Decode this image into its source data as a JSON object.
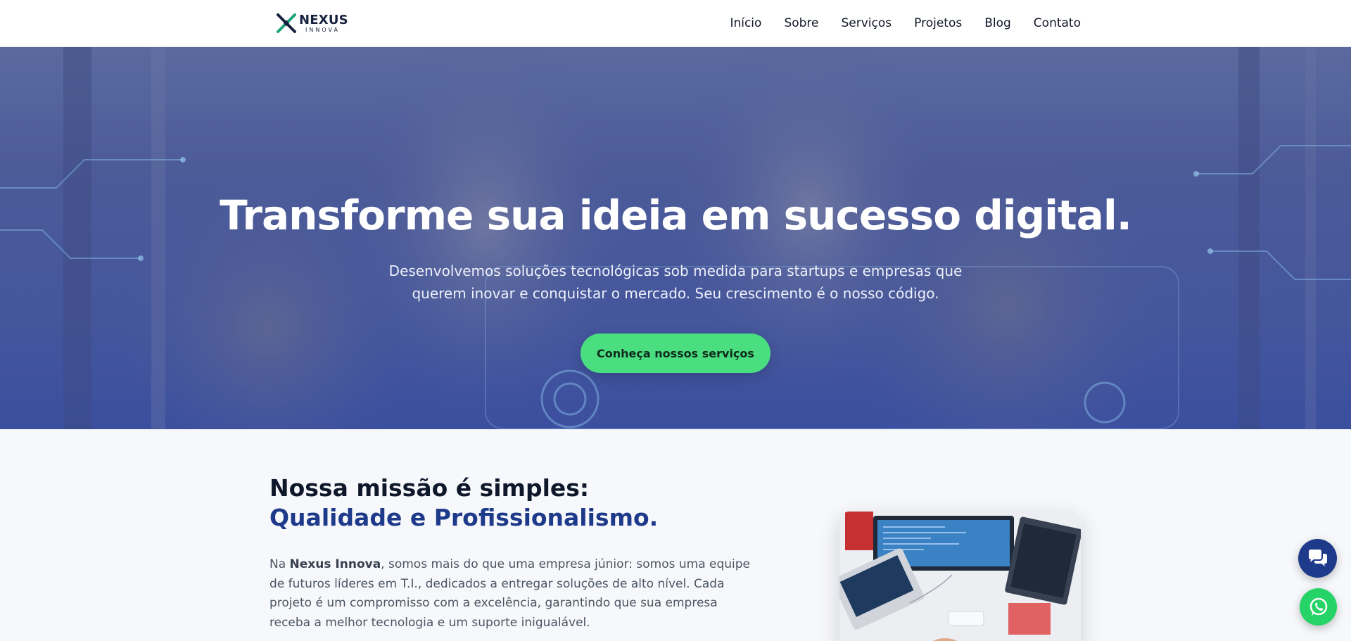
{
  "brand": {
    "name": "NEXUS",
    "sub": "INNOVA",
    "colors": {
      "navy": "#1e3a8a",
      "green": "#4ade80",
      "whatsapp": "#25d366"
    }
  },
  "nav": {
    "items": [
      {
        "label": "Início"
      },
      {
        "label": "Sobre"
      },
      {
        "label": "Serviços"
      },
      {
        "label": "Projetos"
      },
      {
        "label": "Blog"
      },
      {
        "label": "Contato"
      }
    ]
  },
  "hero": {
    "title": "Transforme sua ideia em sucesso digital.",
    "subtitle": "Desenvolvemos soluções tecnológicas sob medida para startups e empresas que querem inovar e conquistar o mercado. Seu crescimento é o nosso código.",
    "cta_label": "Conheça nossos serviços"
  },
  "mission": {
    "title_line1": "Nossa missão é simples:",
    "title_line2": "Qualidade e Profissionalismo.",
    "text_prefix": "Na ",
    "text_bold": "Nexus Innova",
    "text_rest": ", somos mais do que uma empresa júnior: somos uma equipe de futuros líderes em T.I., dedicados a entregar soluções de alto nível. Cada projeto é um compromisso com a excelência, garantindo que sua empresa receba a melhor tecnologia e um suporte inigualável."
  },
  "icons": {
    "logo": "nexus-x-logo",
    "chat": "chat-bubbles-icon",
    "whatsapp": "whatsapp-icon"
  }
}
